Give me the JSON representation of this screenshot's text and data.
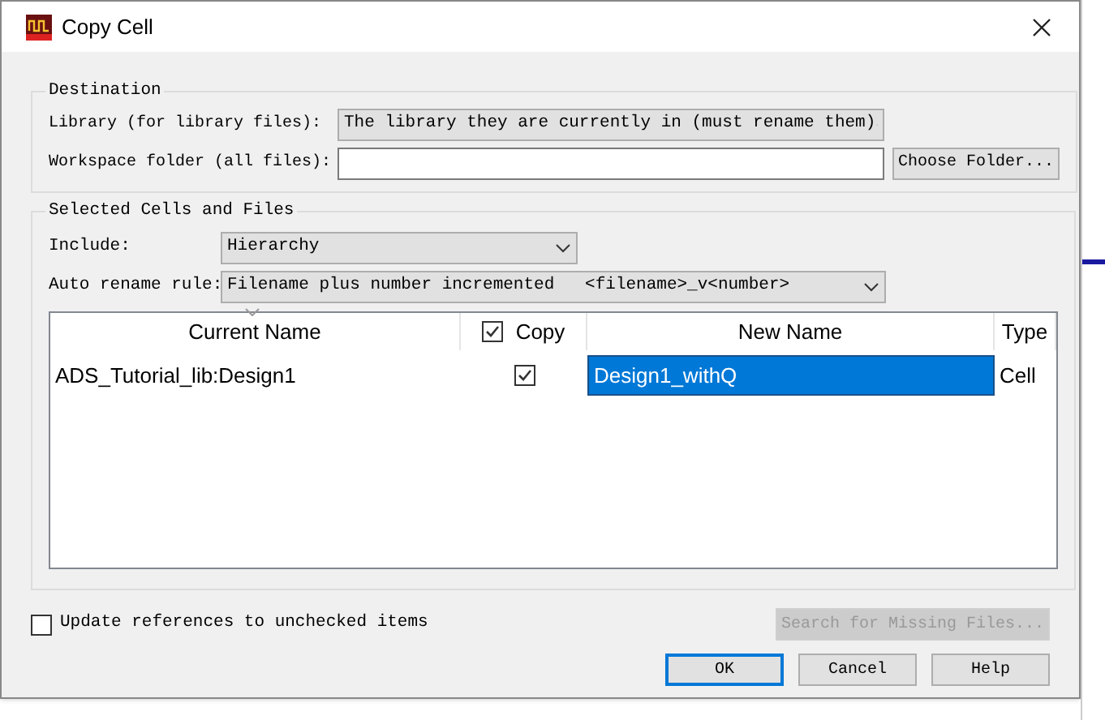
{
  "window": {
    "title": "Copy Cell"
  },
  "destination": {
    "title": "Destination",
    "library_label": "Library (for library files):",
    "library_value": "The library they are currently in (must rename them)",
    "folder_label": "Workspace folder (all files):",
    "choose_button": "Choose Folder..."
  },
  "selected": {
    "title": "Selected Cells and Files",
    "include_label": "Include:",
    "include_value": "Hierarchy",
    "rename_label": "Auto rename rule:",
    "rename_value": "Filename plus number incremented   <filename>_v<number>"
  },
  "table": {
    "columns": [
      {
        "label": "Current Name",
        "sorted": true
      },
      {
        "label": "Copy",
        "checked": true
      },
      {
        "label": "New Name"
      },
      {
        "label": "Type"
      }
    ],
    "rows": [
      {
        "current_name": "ADS_Tutorial_lib:Design1",
        "copy": true,
        "new_name": "Design1_withQ",
        "type": "Cell",
        "selected": true
      }
    ]
  },
  "update_refs": {
    "label": "Update references to unchecked items",
    "checked": false
  },
  "search_button": {
    "label": "Search for Missing Files...",
    "disabled": true
  },
  "buttons": [
    {
      "label": "OK",
      "default": true
    },
    {
      "label": "Cancel",
      "default": false
    },
    {
      "label": "Help",
      "default": false
    }
  ]
}
